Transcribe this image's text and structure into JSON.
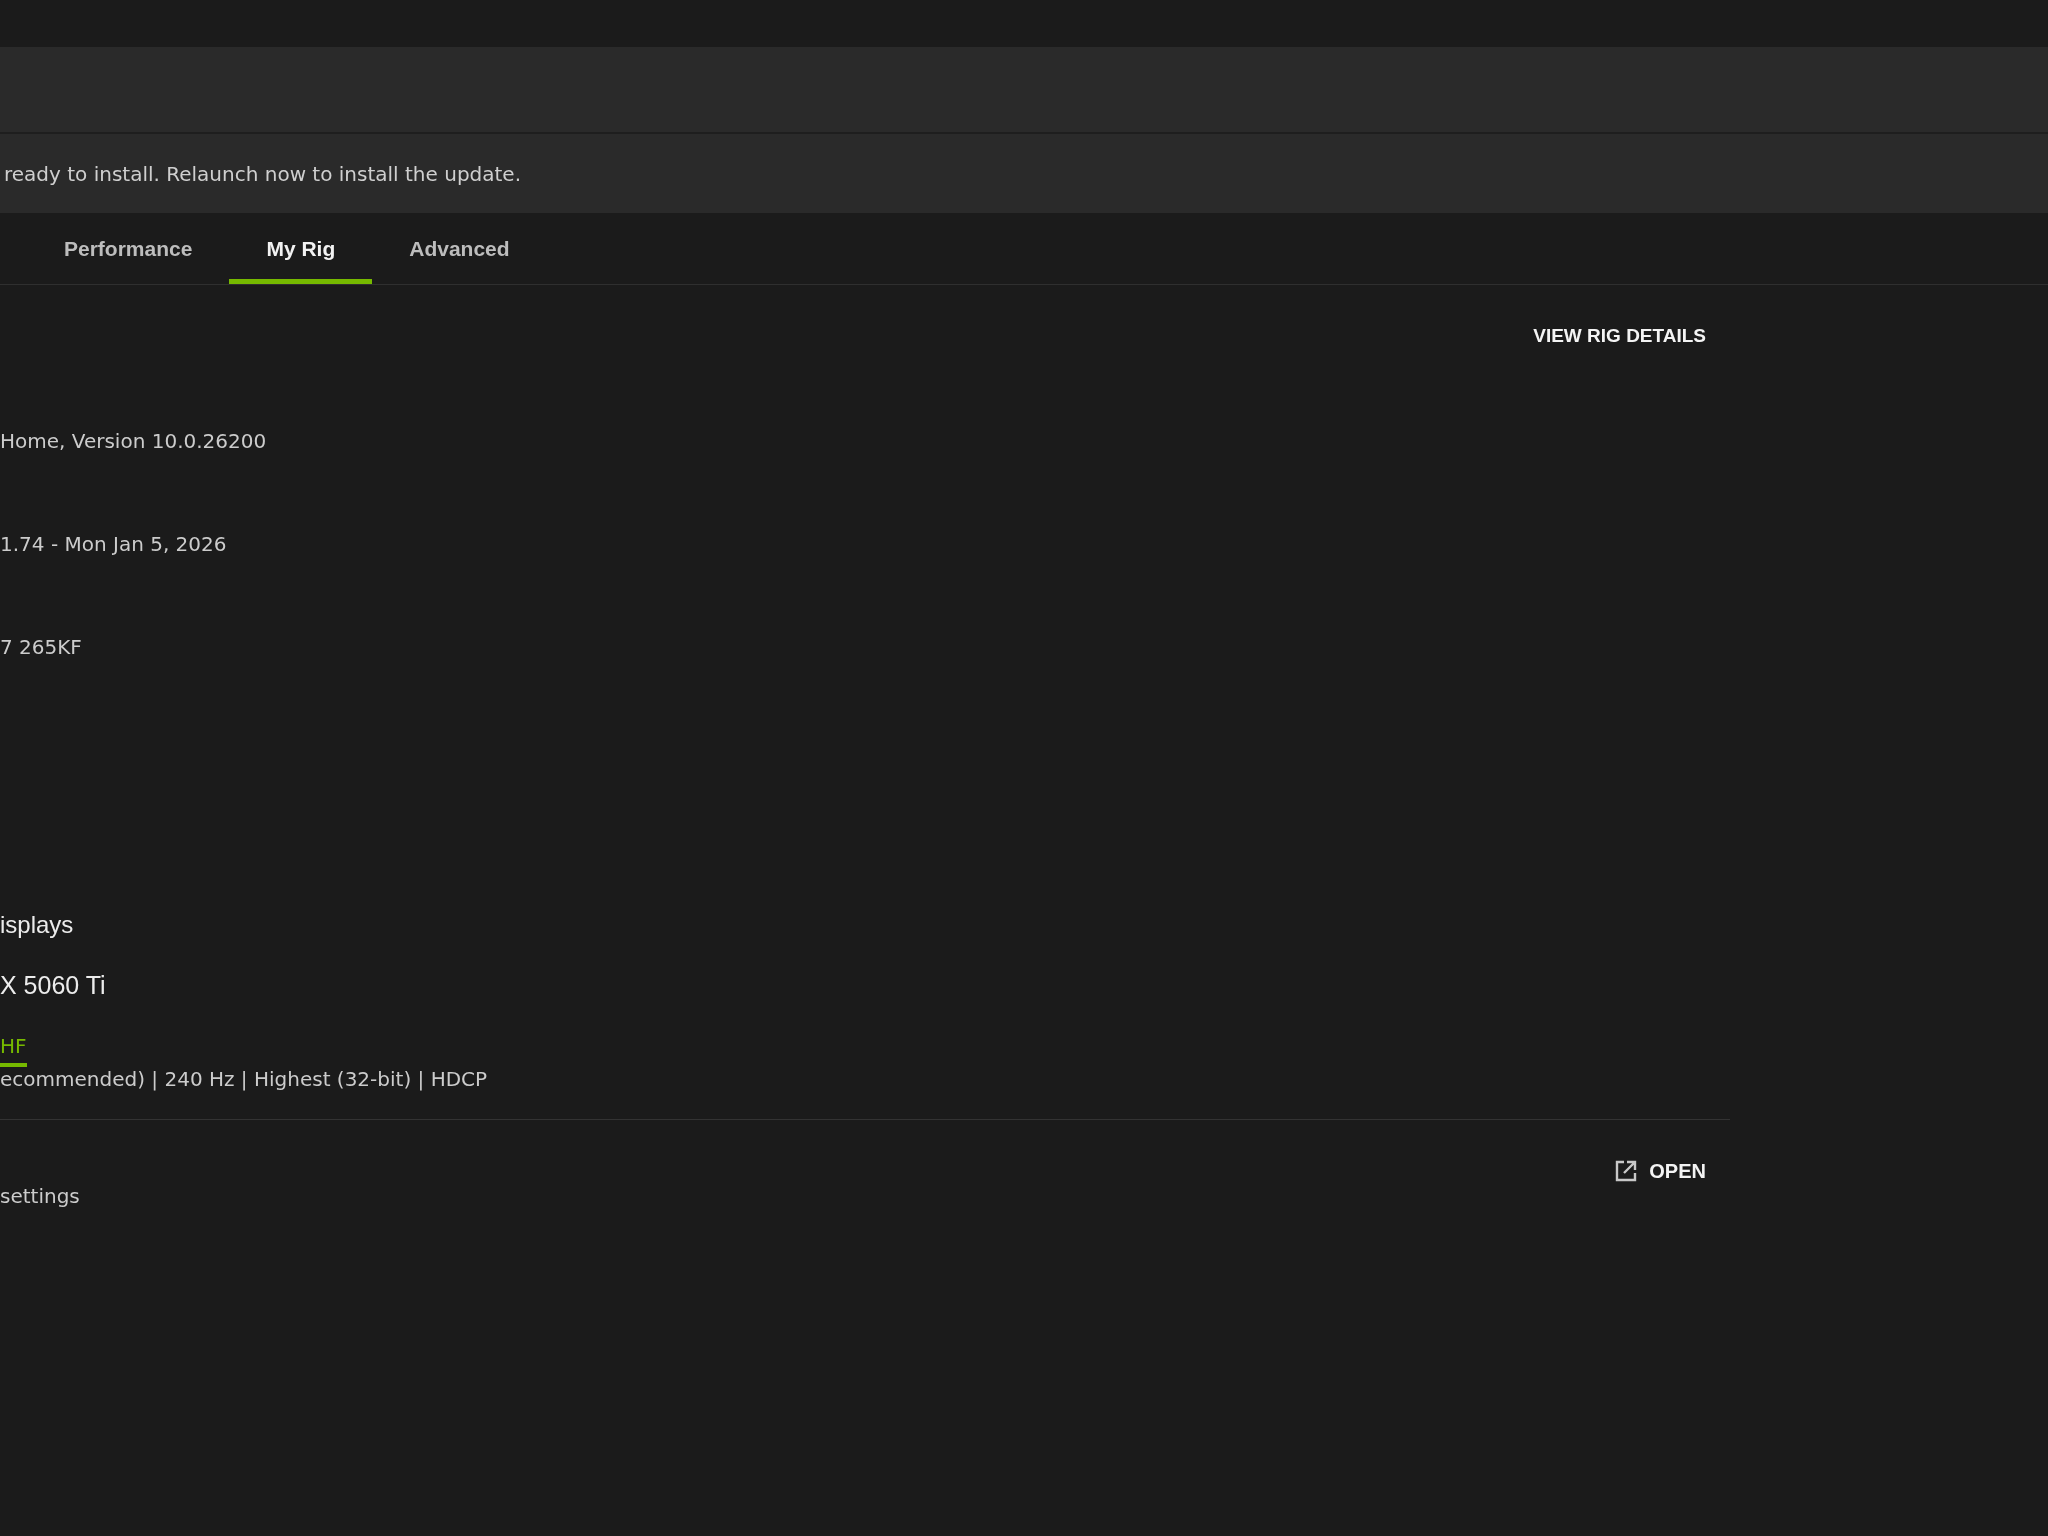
{
  "update_banner": {
    "message": "ready to install. Relaunch now to install the update."
  },
  "tabs": [
    {
      "label": "Performance",
      "selected": false
    },
    {
      "label": "My Rig",
      "selected": true
    },
    {
      "label": "Advanced",
      "selected": false
    }
  ],
  "view_details_button": {
    "label": "VIEW RIG DETAILS"
  },
  "system_info": [
    {
      "value": "Home, Version 10.0.26200"
    },
    {
      "value": "1.74 - Mon Jan 5, 2026"
    },
    {
      "value": "7 265KF"
    }
  ],
  "displays": {
    "heading": "isplays",
    "gpu": "X 5060 Ti",
    "monitor_tabs": [
      {
        "label": "HF",
        "selected": true
      }
    ],
    "details": "ecommended) | 240 Hz | Highest (32-bit) | HDCP"
  },
  "settings_row": {
    "description": "settings",
    "button": "OPEN"
  }
}
